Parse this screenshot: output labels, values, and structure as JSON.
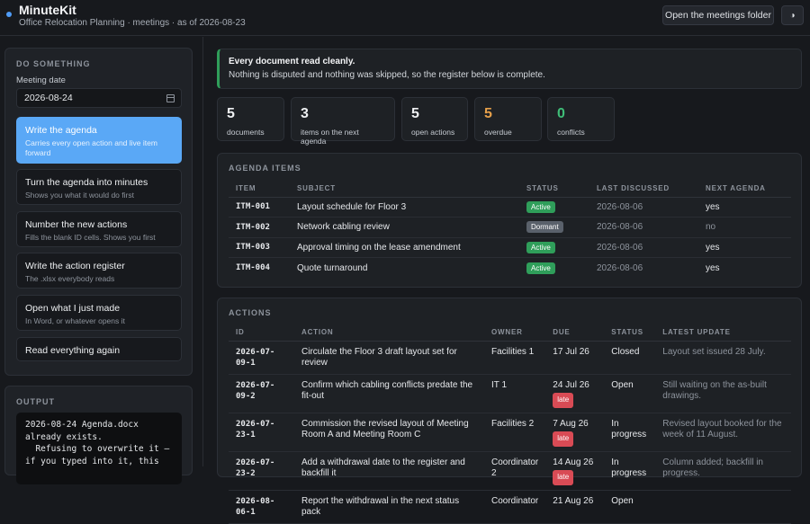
{
  "app": {
    "title": "MinuteKit",
    "subtitle": "Office Relocation Planning · meetings · as of 2026-08-23"
  },
  "header": {
    "open_folder_label": "Open the meetings folder",
    "theme_icon": "◑"
  },
  "sidebar": {
    "section_title": "DO SOMETHING",
    "date_label": "Meeting date",
    "date_value": "2026-08-24",
    "actions": [
      {
        "title": "Write the agenda",
        "desc": "Carries every open action and live item forward"
      },
      {
        "title": "Turn the agenda into minutes",
        "desc": "Shows you what it would do first"
      },
      {
        "title": "Number the new actions",
        "desc": "Fills the blank ID cells. Shows you first"
      },
      {
        "title": "Write the action register",
        "desc": "The .xlsx everybody reads"
      },
      {
        "title": "Open what I just made",
        "desc": "In Word, or whatever opens it"
      },
      {
        "title": "Read everything again",
        "desc": ""
      }
    ],
    "output_title": "OUTPUT",
    "output_text": "2026-08-24 Agenda.docx already exists.\n  Refusing to overwrite it —\nif you typed into it, this"
  },
  "notice": {
    "heading": "Every document read cleanly.",
    "text": "Nothing is disputed and nothing was skipped, so the register below is complete."
  },
  "stats": [
    {
      "value": "5",
      "label": "documents"
    },
    {
      "value": "3",
      "label": "items on the next agenda"
    },
    {
      "value": "5",
      "label": "open actions"
    },
    {
      "value": "5",
      "label": "overdue"
    },
    {
      "value": "0",
      "label": "conflicts"
    }
  ],
  "agenda": {
    "title": "AGENDA ITEMS",
    "columns": [
      "ITEM",
      "SUBJECT",
      "STATUS",
      "LAST DISCUSSED",
      "NEXT AGENDA"
    ],
    "rows": [
      {
        "item": "ITM-001",
        "subject": "Layout schedule for Floor 3",
        "status": "Active",
        "last": "2026-08-06",
        "next": "yes"
      },
      {
        "item": "ITM-002",
        "subject": "Network cabling review",
        "status": "Dormant",
        "last": "2026-08-06",
        "next": "no"
      },
      {
        "item": "ITM-003",
        "subject": "Approval timing on the lease amendment",
        "status": "Active",
        "last": "2026-08-06",
        "next": "yes"
      },
      {
        "item": "ITM-004",
        "subject": "Quote turnaround",
        "status": "Active",
        "last": "2026-08-06",
        "next": "yes"
      }
    ]
  },
  "actions": {
    "title": "ACTIONS",
    "columns": [
      "ID",
      "ACTION",
      "OWNER",
      "DUE",
      "STATUS",
      "LATEST UPDATE"
    ],
    "rows": [
      {
        "id": "2026-07-09-1",
        "action": "Circulate the Floor 3 draft layout set for review",
        "owner": "Facilities 1",
        "due": "17 Jul 26",
        "late": "",
        "status": "Closed",
        "update": "Layout set issued 28 July."
      },
      {
        "id": "2026-07-09-2",
        "action": "Confirm which cabling conflicts predate the fit-out",
        "owner": "IT 1",
        "due": "24 Jul 26",
        "late": "late",
        "status": "Open",
        "update": "Still waiting on the as-built drawings."
      },
      {
        "id": "2026-07-23-1",
        "action": "Commission the revised layout of Meeting Room A and Meeting Room C",
        "owner": "Facilities 2",
        "due": "7 Aug 26",
        "late": "late",
        "status": "In progress",
        "update": "Revised layout booked for the week of 11 August."
      },
      {
        "id": "2026-07-23-2",
        "action": "Add a withdrawal date to the register and backfill it",
        "owner": "Coordinator 2",
        "due": "14 Aug 26",
        "late": "late",
        "status": "In progress",
        "update": "Column added; backfill in progress."
      },
      {
        "id": "2026-08-06-1",
        "action": "Report the withdrawal in the next status pack",
        "owner": "Coordinator",
        "due": "21 Aug 26",
        "late": "",
        "status": "Open",
        "update": ""
      }
    ]
  },
  "colors": {
    "accent": "#5aa8f6",
    "success": "#2f9e5a",
    "warning": "#e6a04a",
    "danger": "#d94b55"
  }
}
